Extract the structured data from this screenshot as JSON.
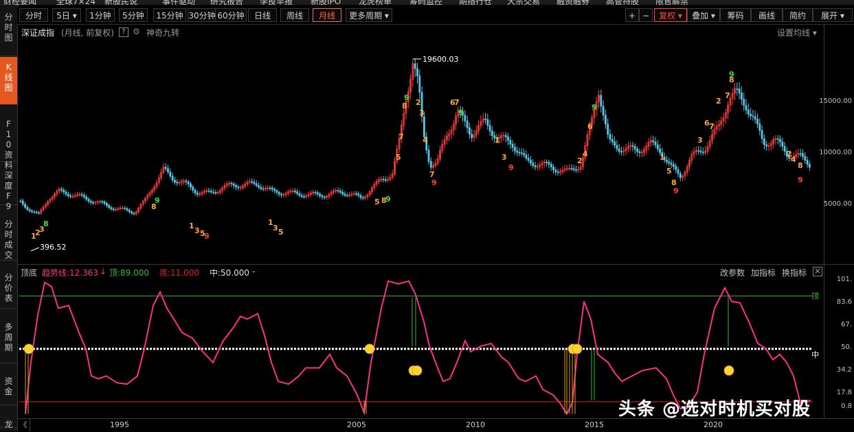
{
  "top_menu": [
    "财经要闻",
    "全球7×24",
    "新股民说",
    "事件驱动",
    "研究报告",
    "李投早报",
    "新股IPO",
    "龙虎榜单",
    "筹码监控",
    "期指行仓",
    "大宗交易",
    "融资融券",
    "高管持股",
    "限售解禁"
  ],
  "sidebar": [
    {
      "label": "分时图",
      "active": false
    },
    {
      "label": "K线图",
      "active": true
    },
    {
      "label": "F10资料",
      "active": false
    },
    {
      "label": "深度F9",
      "active": false
    },
    {
      "label": "分时成交",
      "active": false
    },
    {
      "label": "分价表",
      "active": false
    },
    {
      "label": "多周期",
      "active": false
    },
    {
      "label": "资金",
      "active": false
    },
    {
      "label": "龙",
      "active": false
    }
  ],
  "toolbar": {
    "periods": [
      {
        "label": "分时",
        "active": false
      },
      {
        "label": "5日 ▾",
        "active": false
      },
      {
        "label": "1分钟",
        "active": false
      },
      {
        "label": "5分钟",
        "active": false
      },
      {
        "label": "15分钟",
        "active": false
      },
      {
        "label": "30分钟",
        "active": false
      },
      {
        "label": "60分钟",
        "active": false
      },
      {
        "label": "日线",
        "active": false
      },
      {
        "label": "周线",
        "active": false
      },
      {
        "label": "月线",
        "active": true
      },
      {
        "label": "更多周期 ▾",
        "active": false
      }
    ],
    "zoom_in": "+",
    "zoom_out": "−",
    "adjust": "复权 ▾",
    "overlay": "叠加 ▾",
    "chips": "筹码",
    "draw": "画线",
    "simple": "简约",
    "expand": "展开 ▾"
  },
  "main_chart": {
    "name": "深证成指",
    "mode": "(月线, 前复权)",
    "help": "?",
    "indicator": "神奇九转",
    "settings": "设置均线 ▾",
    "yaxis": [
      "15000.00",
      "10000.00",
      "5000.00"
    ],
    "high_label": "19600.03",
    "low_label": "396.52"
  },
  "indicator_panel": {
    "name": "顶底",
    "trend_label": "趋势线:12.363",
    "trend_arrow": "↓",
    "top_label": "顶:89.000",
    "bottom_label": "底:11.000",
    "mid_label": "中:50.000",
    "dash": "-",
    "buttons": [
      "改参数",
      "加指标",
      "换指标"
    ],
    "close": "×",
    "yaxis": [
      "101.",
      "83.6",
      "67.",
      "50.",
      "34.2",
      "17.8",
      "0.8"
    ],
    "line_top_tag": "顶",
    "line_mid_tag": "中"
  },
  "xaxis": {
    "labels": [
      "1995",
      "2005",
      "2010",
      "2015",
      "2020"
    ]
  },
  "nav_arrow": "《",
  "watermark": "头条 @选对时机买对股",
  "colors": {
    "accent": "#e5581f",
    "up": "#ff3b3b",
    "down": "#54c8e8",
    "trend": "#ff2e8c",
    "top_line": "#2fbf2f",
    "bottom_line": "#e02020",
    "nine_orange": "#ffa53a",
    "nine_green": "#3dde3d",
    "nine_red": "#ff4030"
  }
}
